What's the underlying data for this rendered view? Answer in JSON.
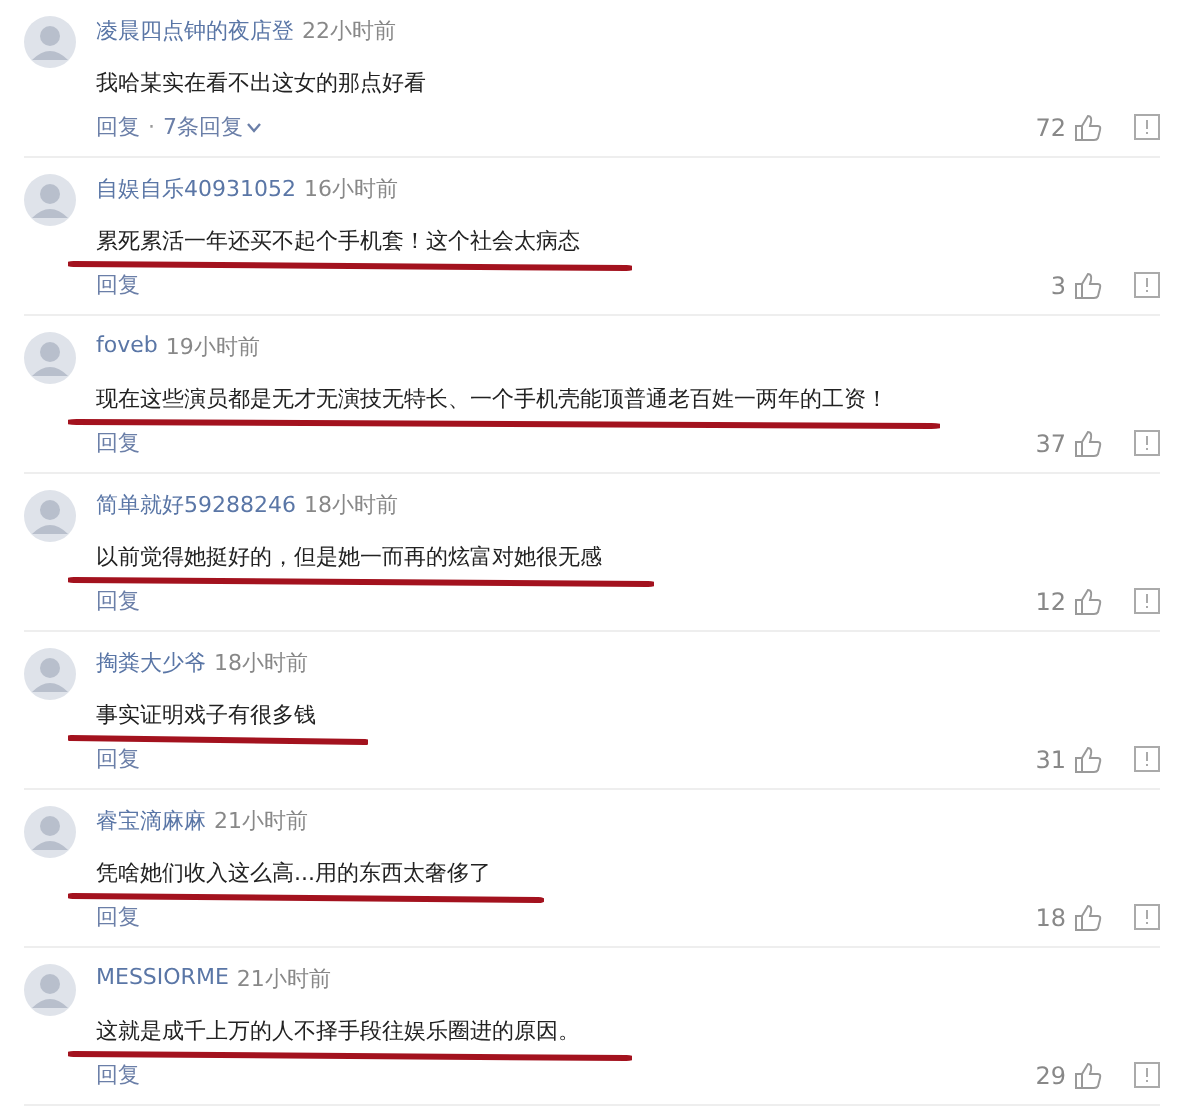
{
  "comments": [
    {
      "user": "凌晨四点钟的夜店登",
      "time": "22小时前",
      "text": "我哈某实在看不出这女的那点好看",
      "reply": "回复",
      "separator": "·",
      "replies": "7条回复",
      "likes": "72",
      "underlined": false
    },
    {
      "user": "自娱自乐40931052",
      "time": "16小时前",
      "text": "累死累活一年还买不起个手机套！这个社会太病态",
      "reply": "回复",
      "likes": "3",
      "underlined": true
    },
    {
      "user": "foveb",
      "time": "19小时前",
      "text": "现在这些演员都是无才无演技无特长、一个手机壳能顶普通老百姓一两年的工资！",
      "reply": "回复",
      "likes": "37",
      "underlined": true
    },
    {
      "user": "简单就好59288246",
      "time": "18小时前",
      "text": "以前觉得她挺好的，但是她一而再的炫富对她很无感",
      "reply": "回复",
      "likes": "12",
      "underlined": true
    },
    {
      "user": "掏粪大少爷",
      "time": "18小时前",
      "text": "事实证明戏子有很多钱",
      "reply": "回复",
      "likes": "31",
      "underlined": true
    },
    {
      "user": "睿宝滴麻麻",
      "time": "21小时前",
      "text": "凭啥她们收入这么高...用的东西太奢侈了",
      "reply": "回复",
      "likes": "18",
      "underlined": true
    },
    {
      "user": "MESSIORME",
      "time": "21小时前",
      "text": "这就是成千上万的人不择手段往娱乐圈进的原因。",
      "reply": "回复",
      "likes": "29",
      "underlined": true
    }
  ]
}
